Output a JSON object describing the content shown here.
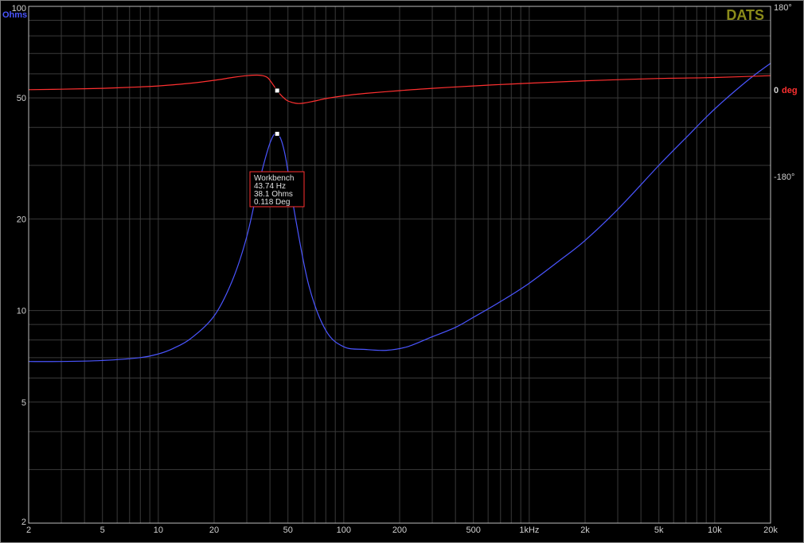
{
  "brand": "DATS",
  "colors": {
    "background": "#000000",
    "grid": "#3a3a3a",
    "impedance": "#4a55ff",
    "phase": "#ff3030",
    "frame": "#bdbdbd",
    "brand": "#8b8b1a"
  },
  "axes": {
    "left_unit": "Ohms",
    "right_unit_zero": "0",
    "right_unit": "deg",
    "right_top": "180°",
    "right_bottom": "-180°"
  },
  "annotation": {
    "lines": [
      "Workbench",
      "43.74 Hz",
      "38.1 Ohms",
      "0.118 Deg"
    ]
  },
  "chart_data": {
    "type": "line",
    "x_scale": "log",
    "y_scale": "log",
    "xlim": [
      2,
      20000
    ],
    "ylim": [
      2,
      100
    ],
    "y2lim": [
      -180,
      180
    ],
    "grid": true,
    "x_ticks": [
      {
        "value": 2,
        "label": "2"
      },
      {
        "value": 5,
        "label": "5"
      },
      {
        "value": 10,
        "label": "10"
      },
      {
        "value": 20,
        "label": "20"
      },
      {
        "value": 50,
        "label": "50"
      },
      {
        "value": 100,
        "label": "100"
      },
      {
        "value": 200,
        "label": "200"
      },
      {
        "value": 500,
        "label": "500"
      },
      {
        "value": 1000,
        "label": "1kHz"
      },
      {
        "value": 2000,
        "label": "2k"
      },
      {
        "value": 5000,
        "label": "5k"
      },
      {
        "value": 10000,
        "label": "10k"
      },
      {
        "value": 20000,
        "label": "20k"
      }
    ],
    "y_ticks": [
      {
        "value": 100,
        "label": "100"
      },
      {
        "value": 50,
        "label": "50"
      },
      {
        "value": 20,
        "label": "20"
      },
      {
        "value": 10,
        "label": "10"
      },
      {
        "value": 5,
        "label": "5"
      },
      {
        "value": 2,
        "label": "2"
      }
    ],
    "series": [
      {
        "key": "impedance",
        "axis": "left",
        "x": [
          2,
          3,
          5,
          8,
          10,
          12,
          15,
          20,
          25,
          30,
          35,
          40,
          43.74,
          48,
          55,
          65,
          80,
          100,
          130,
          170,
          220,
          300,
          400,
          500,
          700,
          1000,
          1500,
          2000,
          3000,
          5000,
          7000,
          10000,
          15000,
          20000
        ],
        "y": [
          6.8,
          6.8,
          6.85,
          7.0,
          7.2,
          7.5,
          8.1,
          9.6,
          12.5,
          17.5,
          26.5,
          35.5,
          38.1,
          33.0,
          20.0,
          12.0,
          8.6,
          7.6,
          7.45,
          7.4,
          7.6,
          8.2,
          8.8,
          9.5,
          10.7,
          12.3,
          14.8,
          17.0,
          21.5,
          30.0,
          37.0,
          46.0,
          57.0,
          65.0
        ]
      },
      {
        "key": "phase",
        "axis": "right",
        "x": [
          2,
          3,
          5,
          8,
          10,
          15,
          20,
          25,
          30,
          35,
          38,
          40,
          43.74,
          47,
          50,
          55,
          60,
          70,
          80,
          100,
          130,
          200,
          300,
          500,
          700,
          1000,
          2000,
          5000,
          10000,
          20000
        ],
        "y": [
          2,
          3,
          5,
          8,
          10,
          16,
          22,
          28,
          32,
          33,
          30,
          22,
          0.118,
          -14,
          -22,
          -27,
          -27,
          -22,
          -17,
          -11,
          -6,
          0,
          5,
          10,
          13,
          16,
          21,
          26,
          28,
          32
        ]
      }
    ],
    "markers": [
      {
        "series": "phase",
        "x": 43.74,
        "y": 0.118
      },
      {
        "series": "impedance",
        "x": 43.74,
        "y": 38.1
      }
    ]
  }
}
